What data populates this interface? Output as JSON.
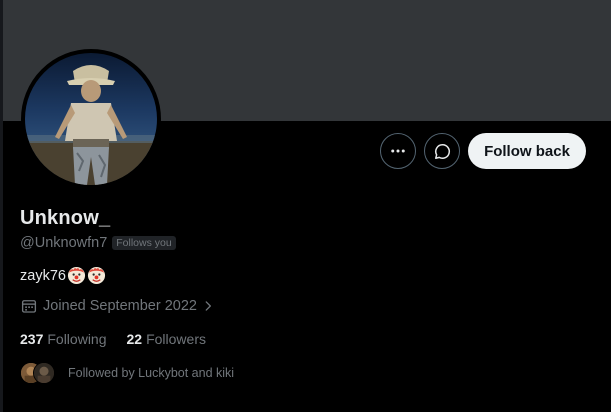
{
  "profile": {
    "display_name": "Unknow_",
    "handle": "@Unknowfn7",
    "follows_you_badge": "Follows you",
    "bio_text": "zayk76",
    "bio_emojis": [
      "clown-face",
      "clown-face"
    ],
    "joined": "Joined September 2022",
    "following_count": "237",
    "following_label": "Following",
    "followers_count": "22",
    "followers_label": "Followers",
    "followed_by": "Followed by Luckybot and kiki"
  },
  "actions": {
    "more_icon": "more-dots-icon",
    "message_icon": "message-icon",
    "follow_back_label": "Follow back"
  },
  "colors": {
    "background": "#000000",
    "banner": "#333639",
    "primary_text": "#e7e9ea",
    "secondary_text": "#71767b",
    "follow_button_bg": "#eff3f4",
    "follow_button_text": "#0f1419"
  }
}
